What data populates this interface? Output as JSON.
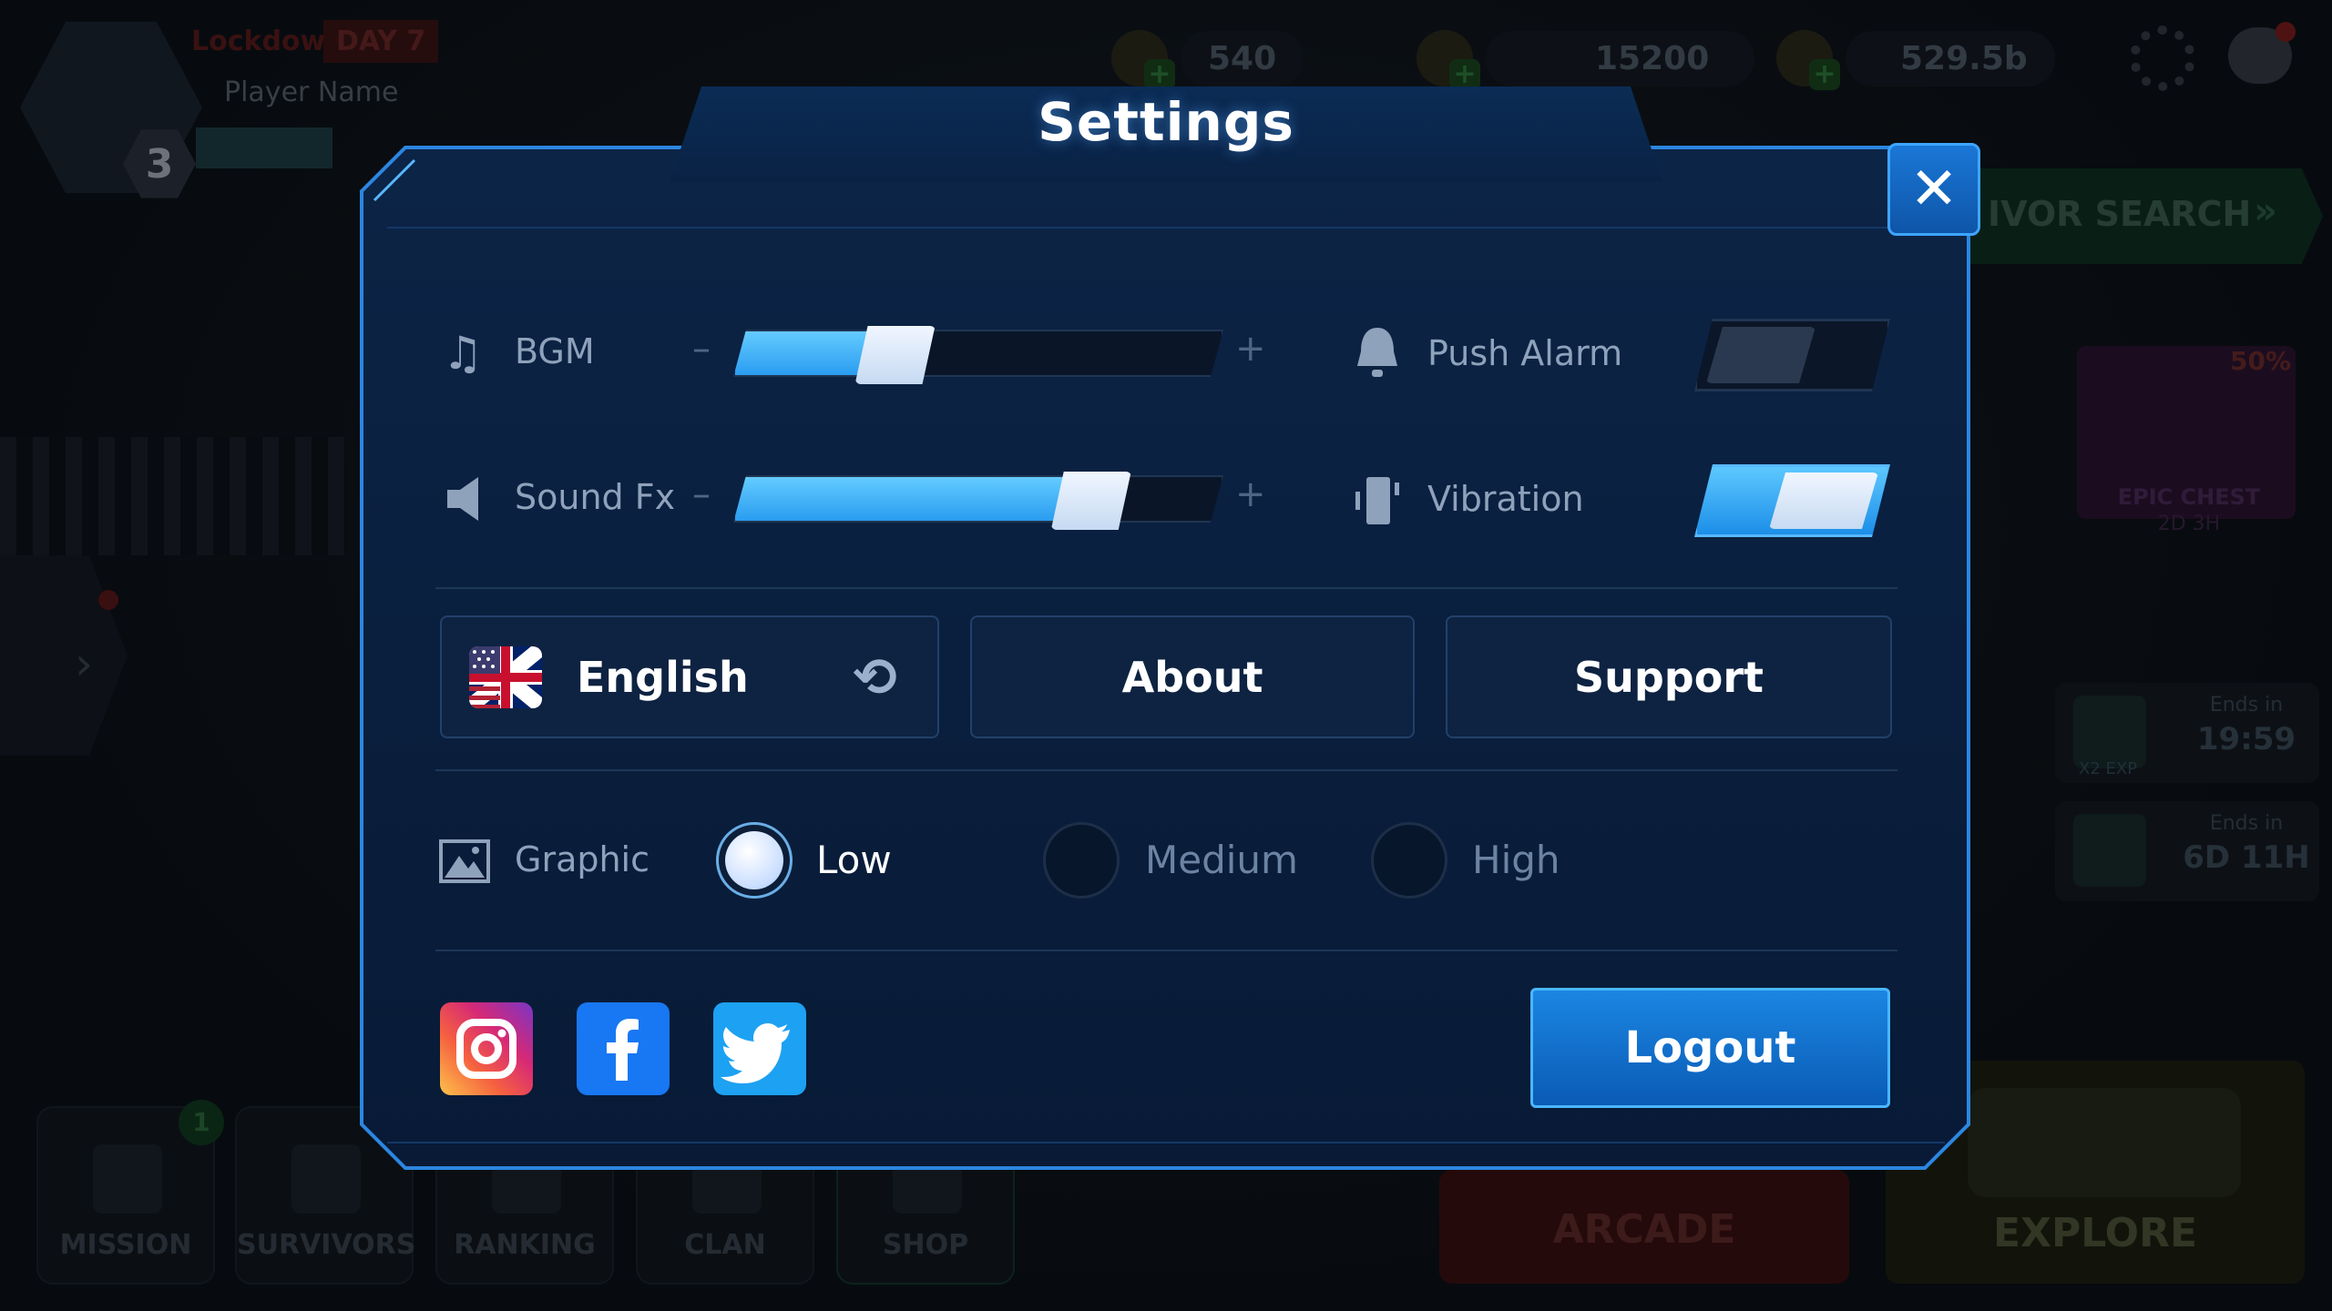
{
  "background": {
    "status_label": "Lockdown",
    "day_label": "DAY 7",
    "player_name": "Player Name",
    "level": "3",
    "resources": [
      {
        "icon": "ammo-icon",
        "value": "540"
      },
      {
        "icon": "gem-icon",
        "value": "15200"
      },
      {
        "icon": "wood-icon",
        "value": "529.5b"
      }
    ],
    "survivor_search_label": "IVOR SEARCH",
    "epic_chest": {
      "discount": "50%",
      "label": "EPIC CHEST",
      "timer": "2D 3H"
    },
    "boosts": [
      {
        "tag": "X2 EXP",
        "ends_label": "Ends in",
        "time": "19:59"
      },
      {
        "tag": "",
        "ends_label": "Ends in",
        "time": "6D 11H"
      }
    ],
    "bottom_tabs": [
      "MISSION",
      "SURVIVORS",
      "RANKING",
      "CLAN",
      "SHOP"
    ],
    "mission_badge": "1",
    "arcade_label": "ARCADE",
    "explore_label": "EXPLORE"
  },
  "settings": {
    "title": "Settings",
    "close_icon": "close-icon",
    "bgm": {
      "label": "BGM",
      "level": 0.33,
      "minus": "–",
      "plus": "+"
    },
    "sound_fx": {
      "label": "Sound Fx",
      "level": 0.73,
      "minus": "–",
      "plus": "+"
    },
    "push_alarm": {
      "label": "Push Alarm",
      "on": false
    },
    "vibration": {
      "label": "Vibration",
      "on": true
    },
    "language": {
      "label": "English",
      "flag_icon": "us-uk-flag-icon",
      "swap_icon": "refresh-icon"
    },
    "about_label": "About",
    "support_label": "Support",
    "graphic": {
      "label": "Graphic",
      "options": [
        "Low",
        "Medium",
        "High"
      ],
      "selected": "Low"
    },
    "social": [
      "instagram-icon",
      "facebook-icon",
      "twitter-icon"
    ],
    "logout_label": "Logout"
  },
  "colors": {
    "panel": "#0a1f3f",
    "accent": "#2a9df0",
    "border": "#3ea5ff"
  }
}
